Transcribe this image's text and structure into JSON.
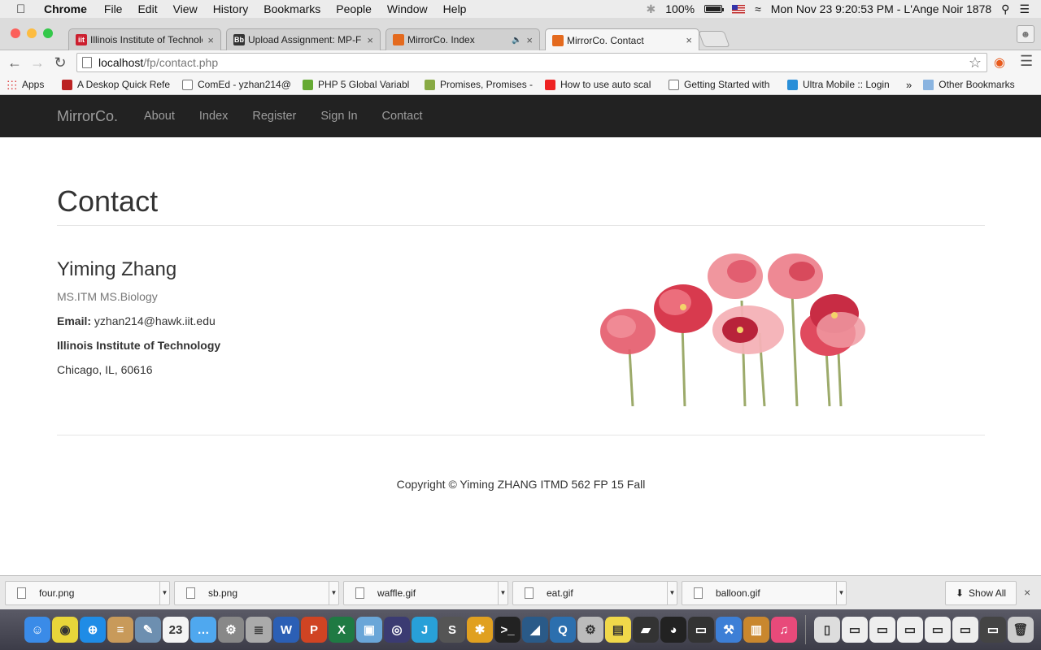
{
  "menubar": {
    "app_name": "Chrome",
    "items": [
      "File",
      "Edit",
      "View",
      "History",
      "Bookmarks",
      "People",
      "Window",
      "Help"
    ],
    "battery_text": "100%",
    "battery_level": 1.0,
    "clock": "Mon Nov 23  9:20:53 PM",
    "user": "L'Ange Noir 1878"
  },
  "tabs": [
    {
      "title": "Illinois Institute of Technolo",
      "favicon_color": "#cc1f2f",
      "favicon_text": "iit",
      "active": false
    },
    {
      "title": "Upload Assignment: MP-Fi",
      "favicon_color": "#333333",
      "favicon_text": "Bb",
      "active": false
    },
    {
      "title": "MirrorCo. Index",
      "favicon_color": "#e46a1e",
      "favicon_text": "",
      "active": false,
      "audio": true
    },
    {
      "title": "MirrorCo. Contact",
      "favicon_color": "#e46a1e",
      "favicon_text": "",
      "active": true
    }
  ],
  "omnibox": {
    "host": "localhost",
    "path": "/fp/contact.php"
  },
  "bookmarks": [
    {
      "label": "Apps",
      "color": "#d44"
    },
    {
      "label": "A Deskop Quick Refe",
      "color": "#b22"
    },
    {
      "label": "ComEd - yzhan214@",
      "color": "#ffffff"
    },
    {
      "label": "PHP 5 Global Variabl",
      "color": "#6a3"
    },
    {
      "label": "Promises, Promises -",
      "color": "#8a4"
    },
    {
      "label": "How to use auto scal",
      "color": "#e22"
    },
    {
      "label": "Getting Started with",
      "color": "#ffffff"
    },
    {
      "label": "Ultra Mobile :: Login",
      "color": "#2a8fd8"
    }
  ],
  "bookmarks_overflow": "»",
  "other_bookmarks": "Other Bookmarks",
  "site": {
    "brand": "MirrorCo.",
    "nav": [
      "About",
      "Index",
      "Register",
      "Sign In",
      "Contact"
    ],
    "page_title": "Contact",
    "name": "Yiming Zhang",
    "degree": "MS.ITM MS.Biology",
    "email_label": "Email:",
    "email": "yzhan214@hawk.iit.edu",
    "institution": "Illinois Institute of Technology",
    "address": "Chicago, IL, 60616",
    "footer": "Copyright © Yiming ZHANG ITMD 562 FP 15 Fall"
  },
  "downloads": [
    "four.png",
    "sb.png",
    "waffle.gif",
    "eat.gif",
    "balloon.gif"
  ],
  "show_all": "Show All",
  "dock": {
    "calendar_day": "23",
    "apps": [
      {
        "name": "finder",
        "color": "#3a8be8",
        "glyph": "☺"
      },
      {
        "name": "chrome",
        "color": "#e8d53a",
        "glyph": "◉"
      },
      {
        "name": "safari",
        "color": "#1f8ce6",
        "glyph": "⊕"
      },
      {
        "name": "notes",
        "color": "#c89a5a",
        "glyph": "≡"
      },
      {
        "name": "preview",
        "color": "#6d8fb0",
        "glyph": "✎"
      },
      {
        "name": "calendar",
        "color": "#f4f4f4",
        "glyph": "23"
      },
      {
        "name": "messages",
        "color": "#4fa8ef",
        "glyph": "…"
      },
      {
        "name": "settings",
        "color": "#888",
        "glyph": "⚙"
      },
      {
        "name": "database",
        "color": "#aaa",
        "glyph": "≣"
      },
      {
        "name": "word",
        "color": "#2b5fb5",
        "glyph": "W"
      },
      {
        "name": "powerpoint",
        "color": "#d04423",
        "glyph": "P"
      },
      {
        "name": "excel",
        "color": "#1f7a43",
        "glyph": "X"
      },
      {
        "name": "virtualbox",
        "color": "#6aa6d8",
        "glyph": "▣"
      },
      {
        "name": "eclipse",
        "color": "#3b3b72",
        "glyph": "◎"
      },
      {
        "name": "intellij",
        "color": "#28a0d8",
        "glyph": "J"
      },
      {
        "name": "sublime",
        "color": "#555",
        "glyph": "S"
      },
      {
        "name": "wireless",
        "color": "#e0a020",
        "glyph": "✱"
      },
      {
        "name": "terminal",
        "color": "#222",
        "glyph": ">_"
      },
      {
        "name": "mysql",
        "color": "#2a5a88",
        "glyph": "◢"
      },
      {
        "name": "quicktime",
        "color": "#2c6fae",
        "glyph": "Q"
      },
      {
        "name": "utility",
        "color": "#bbb",
        "glyph": "⚙"
      },
      {
        "name": "stickies",
        "color": "#f0d84a",
        "glyph": "▤"
      },
      {
        "name": "projector",
        "color": "#333",
        "glyph": "▰"
      },
      {
        "name": "qq",
        "color": "#222",
        "glyph": "◕"
      },
      {
        "name": "console",
        "color": "#333",
        "glyph": "▭"
      },
      {
        "name": "xcode",
        "color": "#3d7fd6",
        "glyph": "⚒"
      },
      {
        "name": "archive",
        "color": "#c9872e",
        "glyph": "▥"
      },
      {
        "name": "itunes",
        "color": "#e84a7a",
        "glyph": "♫"
      },
      {
        "name": "document",
        "color": "#ddd",
        "glyph": "▯"
      },
      {
        "name": "window-1",
        "color": "#eee",
        "glyph": "▭"
      },
      {
        "name": "window-2",
        "color": "#eee",
        "glyph": "▭"
      },
      {
        "name": "window-3",
        "color": "#eee",
        "glyph": "▭"
      },
      {
        "name": "window-4",
        "color": "#eee",
        "glyph": "▭"
      },
      {
        "name": "window-5",
        "color": "#eee",
        "glyph": "▭"
      },
      {
        "name": "window-6",
        "color": "#444",
        "glyph": "▭"
      },
      {
        "name": "trash",
        "color": "#ccc",
        "glyph": "🗑"
      }
    ]
  }
}
